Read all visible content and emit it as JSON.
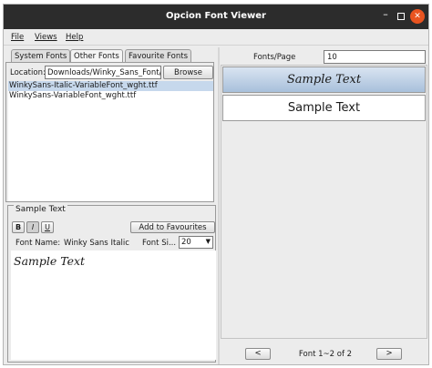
{
  "window": {
    "title": "Opcion Font Viewer",
    "controls": {
      "minimize": "–",
      "close": "✕"
    }
  },
  "menu": {
    "file": "File",
    "views": "Views",
    "help": "Help"
  },
  "tabs": [
    "System Fonts",
    "Other Fonts",
    "Favourite Fonts"
  ],
  "active_tab": "Other Fonts",
  "location": {
    "label": "Location:",
    "value": "Downloads/Winky_Sans_Font/",
    "browse_label": "Browse"
  },
  "files": [
    {
      "name": "WinkySans-Italic-VariableFont_wght.ttf",
      "selected": true
    },
    {
      "name": "WinkySans-VariableFont_wght.ttf",
      "selected": false
    }
  ],
  "sample_panel": {
    "legend": "Sample Text",
    "bold_label": "B",
    "italic_label": "I",
    "underline_label": "U",
    "add_favourites_label": "Add to Favourites",
    "font_name_label": "Font Name:",
    "font_name_value": "Winky Sans Italic",
    "font_size_label": "Font Si...",
    "font_size_value": "20",
    "sample_text": "Sample Text"
  },
  "right_panel": {
    "fonts_per_page_label": "Fonts/Page",
    "fonts_per_page_value": "10",
    "previews": [
      {
        "text": "Sample Text",
        "selected": true
      },
      {
        "text": "Sample Text",
        "selected": false
      }
    ],
    "prev_label": "<",
    "next_label": ">",
    "page_status": "Font 1~2 of 2"
  }
}
